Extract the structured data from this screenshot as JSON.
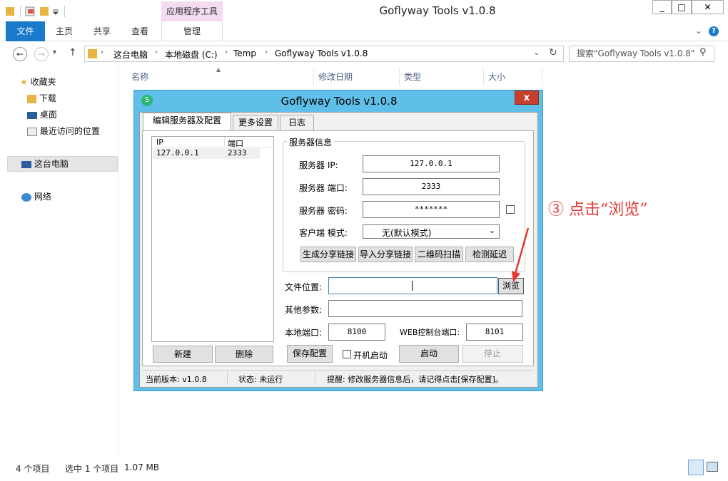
{
  "window": {
    "title": "Goflyway Tools v1.0.8",
    "minimize": "_",
    "maximize": "□",
    "close": "✕",
    "context_tab": "应用程序工具"
  },
  "ribbon": {
    "tabs": [
      "文件",
      "主页",
      "共享",
      "查看",
      "管理"
    ]
  },
  "address": {
    "path": [
      "这台电脑",
      "本地磁盘 (C:)",
      "Temp",
      "Goflyway Tools v1.0.8"
    ],
    "search_placeholder": "搜索\"Goflyway Tools v1.0.8\""
  },
  "nav": {
    "favorites": "收藏夹",
    "downloads": "下载",
    "desktop": "桌面",
    "recent": "最近访问的位置",
    "this_pc": "这台电脑",
    "network": "网络"
  },
  "columns": [
    "名称",
    "修改日期",
    "类型",
    "大小"
  ],
  "statusbar": {
    "items": "4 个项目",
    "selected": "选中 1 个项目",
    "size": "1.07 MB"
  },
  "dialog": {
    "title": "Goflyway Tools   v1.0.8",
    "close": "x",
    "tabs": [
      "编辑服务器及配置",
      "更多设置",
      "日志"
    ],
    "list_headers": [
      "IP",
      "端口"
    ],
    "list_rows": [
      {
        "ip": "127.0.0.1",
        "port": "2333"
      }
    ],
    "btn_new": "新建",
    "btn_delete": "删除",
    "group_label": "服务器信息",
    "server_ip_label": "服务器 IP:",
    "server_ip": "127.0.0.1",
    "server_port_label": "服务器 端口:",
    "server_port": "2333",
    "server_pwd_label": "服务器 密码:",
    "server_pwd": "*******",
    "client_mode_label": "客户端 模式:",
    "client_mode": "无(默认模式)",
    "btn_gen_link": "生成分享链接",
    "btn_import_link": "导入分享链接",
    "btn_qr": "二维码扫描",
    "btn_latency": "检测延迟",
    "file_location_label": "文件位置:",
    "btn_browse": "浏览",
    "other_params_label": "其他参数:",
    "local_port_label": "本地端口:",
    "local_port": "8100",
    "web_port_label": "WEB控制台端口:",
    "web_port": "8101",
    "btn_save": "保存配置",
    "autostart_label": "开机启动",
    "btn_start": "启动",
    "btn_stop": "停止",
    "status_version": "当前版本: v1.0.8",
    "status_state": "状态: 未运行",
    "status_tip": "提醒: 修改服务器信息后，请记得点击[保存配置]。"
  },
  "annotation": "③ 点击“浏览”",
  "colors": {
    "accent": "#1979ca",
    "dialog_frame": "#5fbfe8",
    "annotation": "#e53935"
  }
}
